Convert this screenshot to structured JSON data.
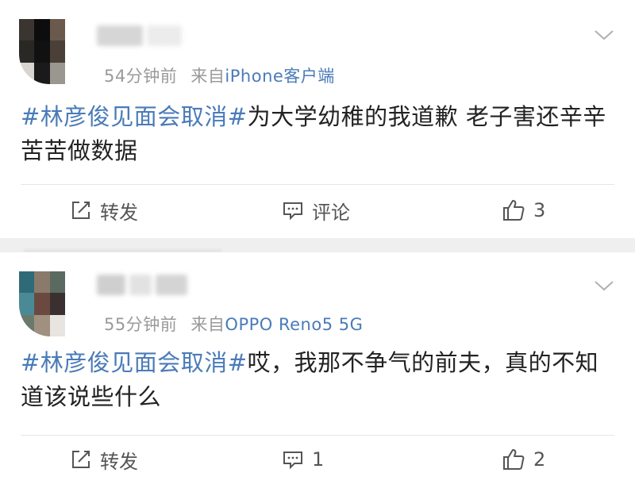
{
  "posts": [
    {
      "time": "54分钟前",
      "from_label": "来自",
      "source": "iPhone客户端",
      "hashtag": "#林彦俊见面会取消#",
      "text": "为大学幼稚的我道歉 老子害还辛辛苦苦做数据",
      "repost_label": "转发",
      "comment_label": "评论",
      "like_count": "3"
    },
    {
      "time": "55分钟前",
      "from_label": "来自",
      "source": "OPPO Reno5 5G",
      "hashtag": "#林彦俊见面会取消#",
      "text": "哎，我那不争气的前夫，真的不知道该说些什么",
      "repost_label": "转发",
      "comment_label": "1",
      "like_count": "2"
    }
  ],
  "colors": {
    "link": "#4a7bb8",
    "meta": "#9a9a9a",
    "divider": "#efefef"
  },
  "icons": [
    "avatar",
    "chevron-down-icon",
    "repost-icon",
    "comment-icon",
    "like-icon"
  ]
}
